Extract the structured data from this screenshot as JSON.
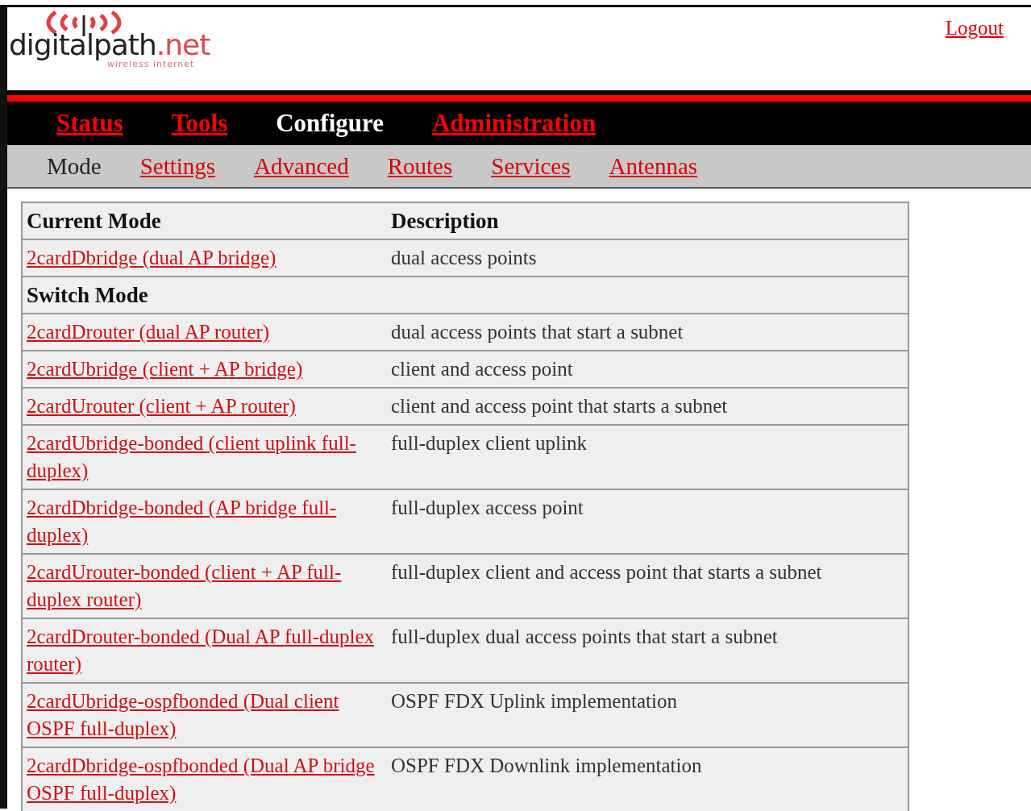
{
  "header": {
    "logo": {
      "name": "digitalpath",
      "suffix": ".net",
      "tagline": "wireless internet"
    },
    "logout": "Logout"
  },
  "main_nav": [
    {
      "label": "Status",
      "selected": false
    },
    {
      "label": "Tools",
      "selected": false
    },
    {
      "label": "Configure",
      "selected": true
    },
    {
      "label": "Administration",
      "selected": false
    }
  ],
  "sub_nav": [
    {
      "label": "Mode",
      "selected": true
    },
    {
      "label": "Settings",
      "selected": false
    },
    {
      "label": "Advanced",
      "selected": false
    },
    {
      "label": "Routes",
      "selected": false
    },
    {
      "label": "Services",
      "selected": false
    },
    {
      "label": "Antennas",
      "selected": false
    }
  ],
  "table": {
    "rows": [
      {
        "kind": "heading",
        "mode": "Current Mode",
        "description": "Description"
      },
      {
        "kind": "mode",
        "mode": "2cardDbridge (dual AP bridge)",
        "description": "dual access points"
      },
      {
        "kind": "heading",
        "mode": "Switch Mode"
      },
      {
        "kind": "mode",
        "mode": "2cardDrouter (dual AP router)",
        "description": "dual access points that start a subnet"
      },
      {
        "kind": "mode",
        "mode": "2cardUbridge (client + AP bridge)",
        "description": "client and access point"
      },
      {
        "kind": "mode",
        "mode": "2cardUrouter (client + AP router)",
        "description": "client and access point that starts a subnet"
      },
      {
        "kind": "mode",
        "mode": "2cardUbridge-bonded (client uplink full-duplex)",
        "description": "full-duplex client uplink"
      },
      {
        "kind": "mode",
        "mode": "2cardDbridge-bonded (AP bridge full-duplex)",
        "description": "full-duplex access point"
      },
      {
        "kind": "mode",
        "mode": "2cardUrouter-bonded (client + AP full-duplex router)",
        "description": "full-duplex client and access point that starts a subnet"
      },
      {
        "kind": "mode",
        "mode": "2cardDrouter-bonded (Dual AP full-duplex router)",
        "description": "full-duplex dual access points that start a subnet"
      },
      {
        "kind": "mode",
        "mode": "2cardUbridge-ospfbonded (Dual client OSPF full-duplex)",
        "description": "OSPF FDX Uplink implementation"
      },
      {
        "kind": "mode",
        "mode": "2cardDbridge-ospfbonded (Dual AP bridge OSPF full-duplex)",
        "description": "OSPF FDX Downlink implementation"
      }
    ]
  }
}
